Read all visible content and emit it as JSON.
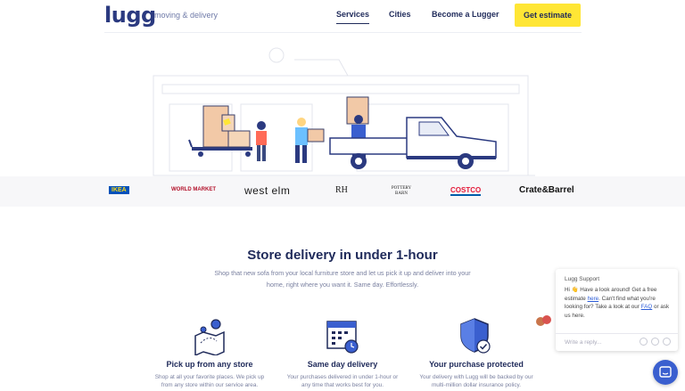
{
  "header": {
    "logo": "lugg",
    "tagline": "moving & delivery",
    "nav": [
      "Services",
      "Cities",
      "Become a Lugger"
    ],
    "cta": "Get estimate"
  },
  "brands": [
    "IKEA",
    "WORLD MARKET",
    "west elm",
    "RH",
    "POTTERY BARN",
    "COSTCO",
    "Crate&Barrel"
  ],
  "main": {
    "title": "Store delivery in under 1-hour",
    "description": "Shop that new sofa from your local furniture store and let us pick it up and deliver into your home, right where you want it. Same day. Effortlessly.",
    "features": [
      {
        "icon": "map-pin-icon",
        "title": "Pick up from any store",
        "desc": "Shop at all your favorite places. We pick up from any store within our service area."
      },
      {
        "icon": "calendar-clock-icon",
        "title": "Same day delivery",
        "desc": "Your purchases delivered in under 1-hour or any time that works best for you."
      },
      {
        "icon": "shield-check-icon",
        "title": "Your purchase protected",
        "desc": "Your delivery with Lugg will be backed by our multi-million dollar insurance policy."
      }
    ]
  },
  "chat": {
    "header": "Lugg Support",
    "msg_part1": "Hi 👋 Have a look around! Get a free estimate ",
    "link_here": "here",
    "msg_part2": ". Can't find what you're looking for? Take a look at our ",
    "link_faq": "FAQ",
    "msg_part3": " or ask us here.",
    "placeholder": "Write a reply..."
  },
  "colors": {
    "brand": "#2b3a80",
    "accent": "#ffe635",
    "launcher": "#3a5fcf"
  }
}
